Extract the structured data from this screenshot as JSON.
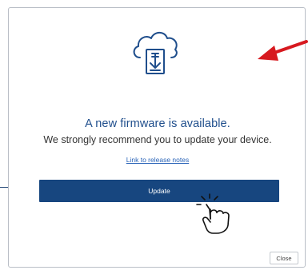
{
  "dialog": {
    "headline": "A new firmware is available.",
    "message": "We strongly recommend you to update your device.",
    "release_notes_link": "Link to release notes",
    "update_label": "Update",
    "close_label": "Close"
  },
  "icons": {
    "main": "cloud-download-icon",
    "annotation_arrow": "red-arrow-icon",
    "annotation_cursor": "pointer-hand-icon"
  },
  "colors": {
    "headline": "#1f4e8c",
    "update_button": "#17467f",
    "annotation_arrow": "#d7191f",
    "link": "#2a64b8"
  }
}
